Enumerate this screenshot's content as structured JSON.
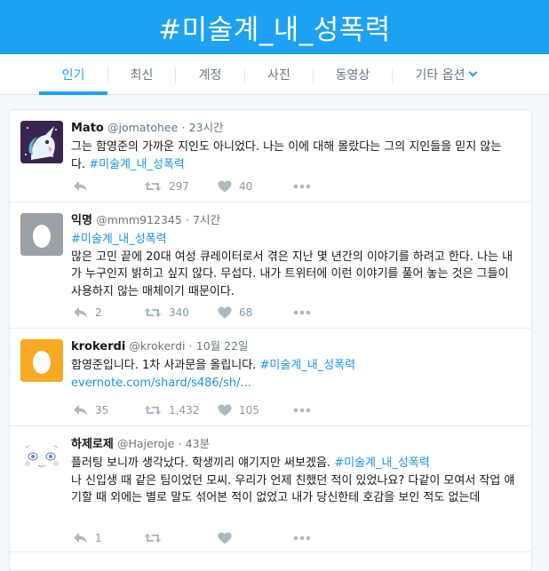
{
  "banner": {
    "title": "#미술계_내_성폭력"
  },
  "nav": {
    "tabs": [
      "인기",
      "최신",
      "계정",
      "사진",
      "동영상"
    ],
    "more_label": "기타 옵션"
  },
  "colors": {
    "accent": "#1da1f2",
    "link": "#1b95e0",
    "muted": "#8899a6"
  },
  "tweets": [
    {
      "name": "Mato",
      "handle": "@jomatohee",
      "time": "23시간",
      "text": "그는 함영준의 가까운 지인도 아니었다. 나는 이에 대해 몰랐다는 그의 지인들을 믿지 않는다.",
      "tag": "#미술계_내_성폭력",
      "reply": "",
      "retweet": "297",
      "like": "40",
      "avatar": "unicorn"
    },
    {
      "name": "익명",
      "handle": "@mmm912345",
      "time": "7시간",
      "tag": "#미술계_내_성폭력",
      "text": "많은 고민 끝에 20대 여성 큐레이터로서 겪은 지난 몇 년간의 이야기를 하려고 한다. 나는 내가 누구인지 밝히고 싶지 않다. 무섭다. 내가 트위터에 이런 이야기를 풀어 놓는 것은 그들이 사용하지 않는 매체이기 때문이다.",
      "reply": "2",
      "retweet": "340",
      "like": "68",
      "avatar": "egg-gray"
    },
    {
      "name": "krokerdi",
      "handle": "@krokerdi",
      "time": "10월 22일",
      "text": "함영준입니다. 1차 사과문을 올립니다.",
      "tag": "#미술계_내_성폭력",
      "url": "evernote.com/shard/s486/sh/...",
      "reply": "35",
      "retweet": "1,432",
      "like": "105",
      "avatar": "egg-orange"
    },
    {
      "name": "하제로제",
      "handle": "@Hajeroje",
      "time": "43분",
      "text": "플러팅 보니까 생각났다. 학생끼리 얘기지만 써보겠음.",
      "tag": "#미술계_내_성폭력",
      "text2": "나 신입생 때 같은 팀이었던 모씨. 우리가 언제 친했던 적이 있었나요? 다같이 모여서 작업 얘기할 때 외에는 별로 말도 섞어본 적이 없었고 내가 당신한테 호감을 보인 적도 없는데",
      "reply": "1",
      "retweet": "",
      "like": "",
      "avatar": "drawing"
    }
  ]
}
